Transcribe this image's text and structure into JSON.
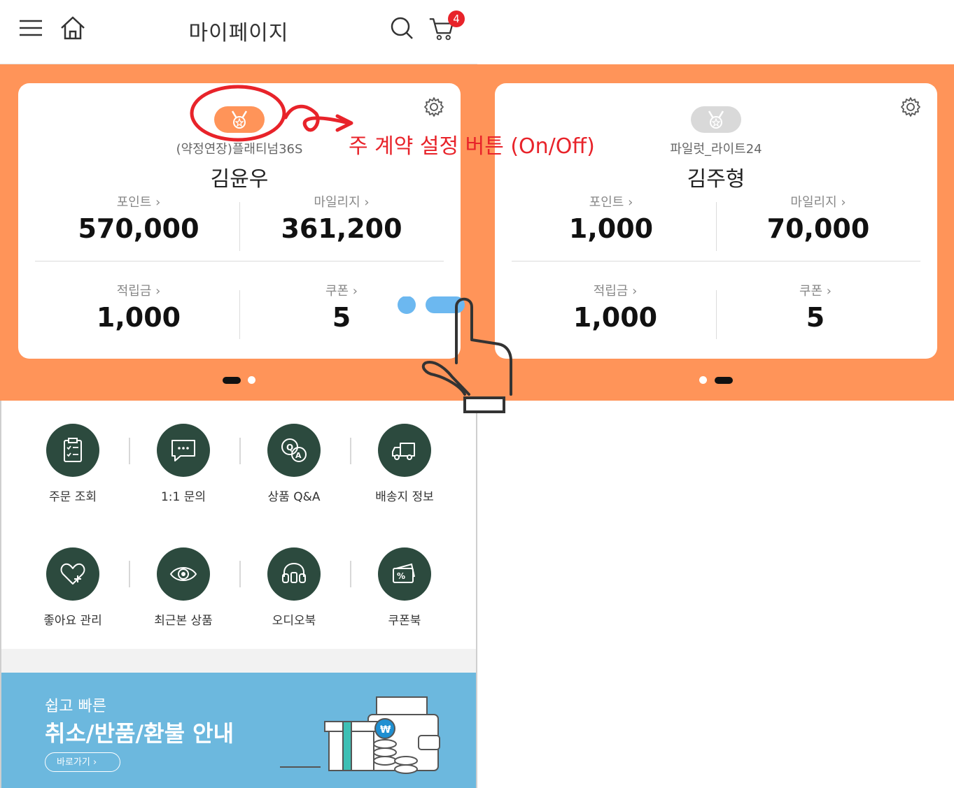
{
  "header": {
    "title": "마이페이지",
    "cart_count": "4",
    "menu_icon": "hamburger-icon",
    "home_icon": "home-icon",
    "search_icon": "search-icon",
    "cart_icon": "cart-icon"
  },
  "colors": {
    "band": "#ff9459",
    "menu_circle": "#2c4a3e",
    "banner": "#6cb8de",
    "annotation": "#e8232a",
    "badge": "#e8232a",
    "pager": "#6cb8f0"
  },
  "cards": [
    {
      "grade": "(약정연장)플래티넘36S",
      "name": "김윤우",
      "point_label": "포인트 ›",
      "point_value": "570,000",
      "mileage_label": "마일리지 ›",
      "mileage_value": "361,200",
      "reserve_label": "적립금 ›",
      "reserve_value": "1,000",
      "coupon_label": "쿠폰 ›",
      "coupon_value": "5"
    },
    {
      "grade": "파일럿_라이트24",
      "name": "김주형",
      "point_label": "포인트 ›",
      "point_value": "1,000",
      "mileage_label": "마일리지 ›",
      "mileage_value": "70,000",
      "reserve_label": "적립금 ›",
      "reserve_value": "1,000",
      "coupon_label": "쿠폰 ›",
      "coupon_value": "5"
    }
  ],
  "annotation": "주 계약 설정 버튼 (On/Off)",
  "menu": [
    {
      "label": "주문 조회",
      "icon": "order-clipboard-icon"
    },
    {
      "label": "1:1 문의",
      "icon": "chat-bubble-icon"
    },
    {
      "label": "상품 Q&A",
      "icon": "qa-bubbles-icon"
    },
    {
      "label": "배송지 정보",
      "icon": "delivery-truck-icon"
    },
    {
      "label": "좋아요 관리",
      "icon": "heart-plus-icon"
    },
    {
      "label": "최근본 상품",
      "icon": "eye-icon"
    },
    {
      "label": "오디오북",
      "icon": "headphones-icon"
    },
    {
      "label": "쿠폰북",
      "icon": "coupon-icon"
    }
  ],
  "banner": {
    "subtitle": "쉽고 빠른",
    "title": "취소/반품/환불 안내",
    "button": "바로가기 ›"
  }
}
